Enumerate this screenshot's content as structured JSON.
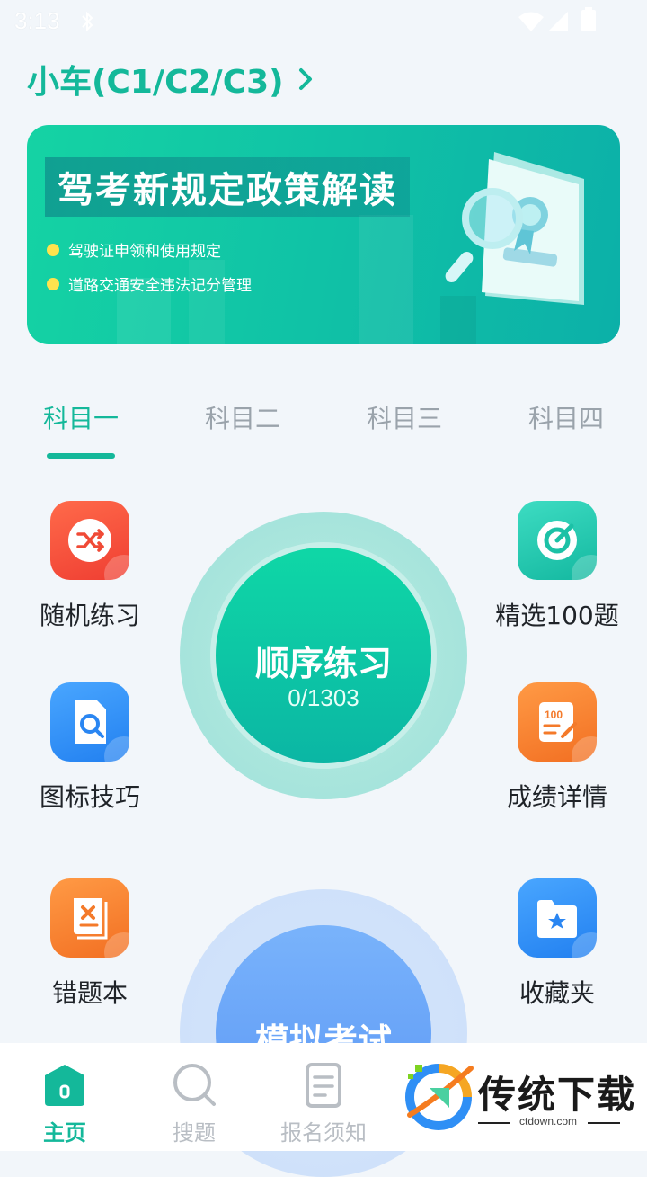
{
  "status_bar": {
    "time": "3:13"
  },
  "header": {
    "car_type": "小车(C1/C2/C3)"
  },
  "banner": {
    "title": "驾考新规定政策解读",
    "bullets": [
      "驾驶证申领和使用规定",
      "道路交通安全违法记分管理"
    ]
  },
  "tabs": [
    {
      "label": "科目一",
      "active": true
    },
    {
      "label": "科目二",
      "active": false
    },
    {
      "label": "科目三",
      "active": false
    },
    {
      "label": "科目四",
      "active": false
    }
  ],
  "features": {
    "random": {
      "label": "随机练习",
      "color": "#f5503a"
    },
    "selected100": {
      "label": "精选100题",
      "color": "#1fc6a6"
    },
    "sign_tips": {
      "label": "图标技巧",
      "color": "#2f8ff5"
    },
    "score_detail": {
      "label": "成绩详情",
      "color": "#f7812f"
    },
    "wrong_book": {
      "label": "错题本",
      "color": "#f7822f"
    },
    "favorites": {
      "label": "收藏夹",
      "color": "#2f8ff5"
    }
  },
  "sequence": {
    "title": "顺序练习",
    "count": "0/1303"
  },
  "mock_exam": {
    "title": "模拟考试"
  },
  "bottom_nav": [
    {
      "label": "主页",
      "active": true
    },
    {
      "label": "搜题",
      "active": false
    },
    {
      "label": "报名须知",
      "active": false
    }
  ],
  "watermark": {
    "text": "传统下载",
    "url": "ctdown.com"
  },
  "colors": {
    "accent": "#14b89a"
  }
}
